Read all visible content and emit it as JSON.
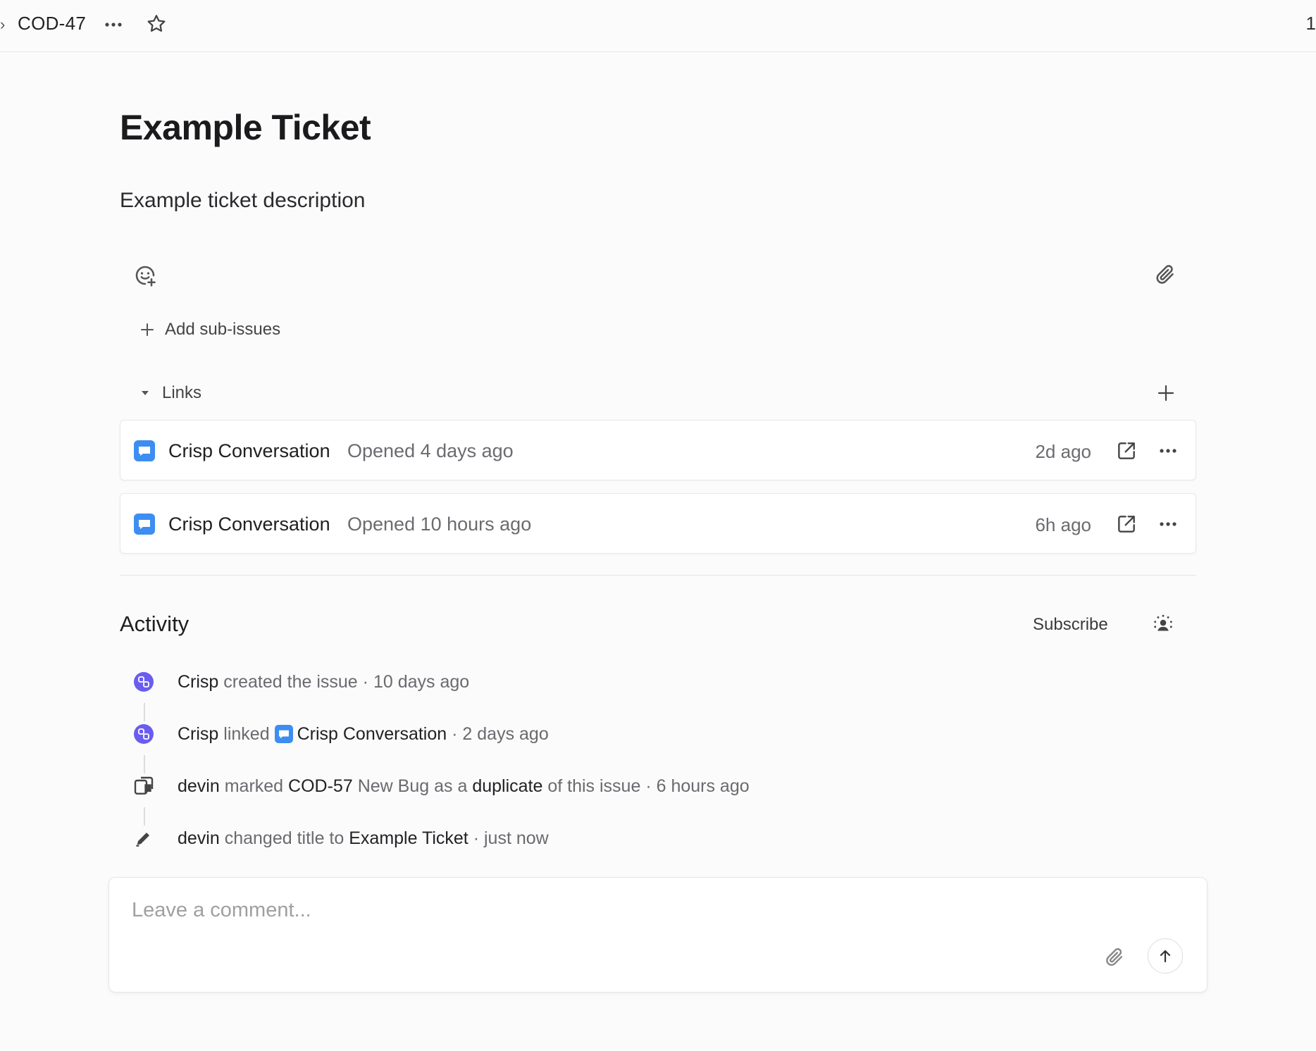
{
  "topbar": {
    "ticket_id": "COD-47",
    "edge_text": "1"
  },
  "issue": {
    "title": "Example Ticket",
    "description": "Example ticket description"
  },
  "sub_issues": {
    "add_label": "Add sub-issues"
  },
  "links": {
    "header": "Links",
    "items": [
      {
        "name": "Crisp Conversation",
        "status": "Opened 4 days ago",
        "time": "2d ago"
      },
      {
        "name": "Crisp Conversation",
        "status": "Opened 10 hours ago",
        "time": "6h ago"
      }
    ]
  },
  "activity": {
    "title": "Activity",
    "subscribe_label": "Subscribe",
    "events": [
      {
        "actor": "Crisp",
        "action": "created the issue",
        "sep": "·",
        "time": "10 days ago"
      },
      {
        "actor": "Crisp",
        "action": "linked",
        "target": "Crisp Conversation",
        "sep": "·",
        "time": "2 days ago"
      },
      {
        "actor": "devin",
        "action": "marked",
        "issue_id": "COD-57",
        "issue_title": "New Bug",
        "mid": "as a",
        "relation": "duplicate",
        "tail": "of this issue",
        "sep": "·",
        "time": "6 hours ago"
      },
      {
        "actor": "devin",
        "action": "changed title to",
        "target": "Example Ticket",
        "sep": "·",
        "time": "just now"
      }
    ]
  },
  "comment": {
    "placeholder": "Leave a comment..."
  },
  "colors": {
    "crisp_icon": "#3d8ef0",
    "integration_icon": "#6b5cf0",
    "text_primary": "#1f1f22",
    "text_secondary": "#6b6b70"
  }
}
